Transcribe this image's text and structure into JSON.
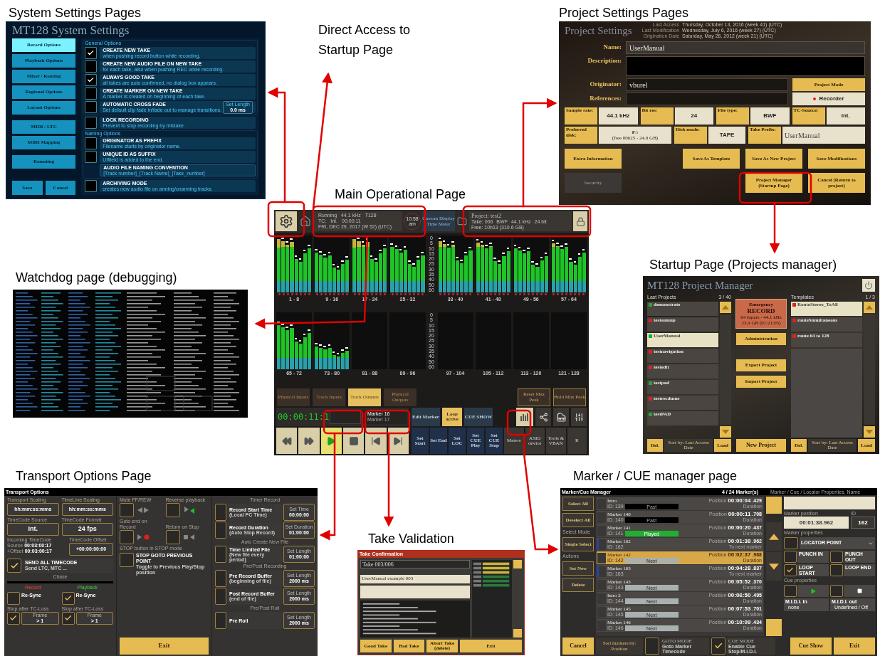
{
  "captions": [
    "System Settings Pages",
    "Direct Access to Startup Page",
    "Project Settings Pages",
    "Main Operational Page",
    "Watchdog page (debugging)",
    "Startup Page (Projects manager)",
    "Transport Options Page",
    "Take Validation",
    "Marker / CUE manager page"
  ],
  "system_settings": {
    "title": "MT128 System Settings",
    "menu_groups": [
      [
        {
          "label": "Record Options",
          "selected": true
        },
        {
          "label": "Playback Options",
          "selected": false
        },
        {
          "label": "Mixer / Routing",
          "selected": false
        },
        {
          "label": "Regional Options",
          "selected": false
        },
        {
          "label": "Layout Options",
          "selected": false
        }
      ],
      [
        {
          "label": "MIDI / LTC",
          "selected": false
        },
        {
          "label": "MIDI Mapping",
          "selected": false
        }
      ],
      [
        {
          "label": "Remoting",
          "selected": false
        }
      ]
    ],
    "footer_buttons": [
      "Save",
      "Cancel"
    ],
    "general_label": "General Options",
    "general_options": [
      {
        "title": "CREATE NEW TAKE",
        "description": "when pushing record button while recording.",
        "checked": true
      },
      {
        "title": "CREATE NEW AUDIO FILE ON NEW TAKE",
        "description": "for each take, also when pushing REC while recording.",
        "checked": false
      },
      {
        "title": "ALWAYS GOOD TAKE",
        "description": "all takes are auto confirmed, no dialog box appears.",
        "checked": true
      },
      {
        "title": "CREATE MARKER ON NEW TAKE",
        "description": "A marker is created on beginning of each take.",
        "checked": false
      },
      {
        "title": "AUTOMATIC CROSS FADE",
        "description": "Set default clip fade in/fade out to manage transitions.",
        "checked": false,
        "setting_label": "Set Length",
        "setting": "0.0 ms"
      }
    ],
    "lock_option": {
      "title": "LOCK RECORDING",
      "description": "Prevent to stop recording by mistake.",
      "checked": false
    },
    "naming_label": "Naming Options",
    "naming_options": [
      {
        "title": "ORIGINATOR AS PREFIX",
        "description": "Filename starts by originator name.",
        "checked": false
      },
      {
        "title": "UNIQUE ID AS SUFFIX",
        "description": "UIfileId is added to the end.",
        "checked": false
      }
    ],
    "naming_convention": {
      "title": "AUDIO FILE NAMING CONVENTION",
      "description": "[Track number]_[Track Name]_[Take_number]"
    },
    "archiving_option": {
      "title": "ARCHIVING MODE",
      "description": "creates new audio file on arming/unarming tracks.",
      "checked": false
    }
  },
  "project_settings": {
    "title": "Project Settings",
    "meta": [
      {
        "label": "Last Access",
        "value": "Thursday, October 13, 2016 (week 41) (UTC)"
      },
      {
        "label": "Last Modification",
        "value": "Wednesday, July 6, 2016 (week 27) (UTC)"
      },
      {
        "label": "Origination Date",
        "value": "Saturday, May 26, 2012 (week 21) (UTC)"
      }
    ],
    "name_label": "Name:",
    "name": "UserManual",
    "description_label": "Description:",
    "originator_label": "Originator:",
    "originator": "vburel",
    "references_label": "References:",
    "project_mode_label": "Project Mode",
    "project_mode": "Recorder",
    "params": [
      {
        "label": "Sample rate:",
        "value": "44.1 kHz"
      },
      {
        "label": "Bit res:",
        "value": "24"
      },
      {
        "label": "File type:",
        "value": "BWF"
      },
      {
        "label": "TC-Source:",
        "value": "Int."
      }
    ],
    "disk": {
      "label": "Preferred disk:",
      "value": "F:\\",
      "detail": "(free 00h25 - 24.0 GB)"
    },
    "disk_mode": {
      "label": "Disk mode:",
      "value": "TAPE"
    },
    "take_prefix": {
      "label": "Take Prefix:",
      "value": "UserManual"
    },
    "buttons": [
      {
        "label": "Extra Information",
        "kind": "gold"
      },
      {
        "label": "Save As Template",
        "kind": "gold"
      },
      {
        "label": "Save As New Project",
        "kind": "gold"
      },
      {
        "label": "Save Modifications",
        "kind": "gold"
      },
      {
        "label": "Security",
        "kind": "dark"
      },
      {
        "label": "Project Manager (Startup Page)",
        "kind": "gold"
      },
      {
        "label": "Cancel (Return to project)",
        "kind": "gold"
      }
    ]
  },
  "main_page": {
    "status": "Running",
    "tc_label": "TC:",
    "rate": "44.1 kHz",
    "tracks": "T128",
    "source": "Int.",
    "timecode": "00:00:11",
    "date": "FRI, DEC 29, 2017 (W 52) (UTC)",
    "clock": "10:58",
    "ampm": "am",
    "display_button": "Custom Display Time Meter",
    "project": "Project: test2",
    "take": "Take: 006",
    "format": "BWF",
    "project_rate": "44.1 kHz",
    "bits": "24 bit",
    "free": "Free: 10h13 (310.6 GB)",
    "meter_rows": [
      {
        "scale": [
          "0",
          "5",
          "10",
          "15",
          "20",
          "25",
          "30",
          "35",
          "40",
          "50",
          "60"
        ],
        "groups": [
          {
            "label": "1 - 8",
            "level": 0.95
          },
          {
            "label": "9 - 16",
            "level": 0.7
          },
          {
            "label": "17 - 24",
            "level": 0.95
          },
          {
            "label": "25 - 32",
            "level": 0.8
          },
          {
            "label": "33 - 40",
            "level": 0.9
          },
          {
            "label": "41 - 48",
            "level": 0.88
          },
          {
            "label": "49 - 56",
            "level": 0.78
          },
          {
            "label": "57 - 64",
            "level": 0.86
          }
        ]
      },
      {
        "scale": [
          "0",
          "5",
          "10",
          "15",
          "20",
          "25",
          "30",
          "35",
          "40",
          "50",
          "60"
        ],
        "groups": [
          {
            "label": "65 - 72",
            "level": 0.78
          },
          {
            "label": "73 - 80",
            "level": 0.4
          },
          {
            "label": "81 - 88",
            "level": 0
          },
          {
            "label": "89 - 96",
            "level": 0
          },
          {
            "label": "97 - 104",
            "level": 0
          },
          {
            "label": "105 - 112",
            "level": 0
          },
          {
            "label": "113 - 120",
            "level": 0
          },
          {
            "label": "121 - 128",
            "level": 0
          }
        ]
      }
    ],
    "tabs": [
      {
        "label": "Physical Inputs",
        "selected": false
      },
      {
        "label": "Track Inputs",
        "selected": false
      },
      {
        "label": "Track Outputs",
        "selected": true
      },
      {
        "label": "Physical Outputs",
        "selected": false
      }
    ],
    "peak_buttons": [
      "Reset Max Peak",
      "Hold Max Peak"
    ],
    "time": "00:00:11:1",
    "marker": "Marker 16",
    "next_marker": "Marker 17",
    "marker_buttons": [
      {
        "label": "Edit Marker",
        "on": false
      },
      {
        "label": "Loop active",
        "on": true
      },
      {
        "label": "CUE SHOW",
        "on": false
      }
    ],
    "set_buttons": [
      "Set Start",
      "Set End",
      "Set LOC",
      "Set CUE Play",
      "Set CUE Stop"
    ],
    "tool_buttons": [
      "Meters",
      "ASIO device",
      "Tools & VBAN",
      "R"
    ]
  },
  "startup_page": {
    "title": "MT128 Project Manager",
    "projects_label": "Last Projects",
    "projects_count": "3 / 40",
    "templates_label": "Templates",
    "templates_count": "1 / 3",
    "projects": [
      {
        "name": "demonstrate",
        "color": "#22aa33",
        "selected": false
      },
      {
        "name": "testsumup",
        "color": "#dd2222",
        "selected": false
      },
      {
        "name": "UserManual",
        "color": "#22aa33",
        "selected": true
      },
      {
        "name": "testnavigation",
        "color": "#dd2222",
        "selected": false
      },
      {
        "name": "testedit",
        "color": "#dd2222",
        "selected": false
      },
      {
        "name": "testpad",
        "color": "#22aa33",
        "selected": false
      },
      {
        "name": "testrecdume",
        "color": "#dd2222",
        "selected": false
      },
      {
        "name": "testPAD",
        "color": "#22aa33",
        "selected": false
      }
    ],
    "templates": [
      {
        "name": "RouteStereo_ToAll",
        "color": "#dd2222",
        "selected": true
      },
      {
        "name": "routeSimultaneous",
        "color": "#dd2222",
        "selected": false
      },
      {
        "name": "route 64 to 128",
        "color": "#dd2222",
        "selected": false
      }
    ],
    "emergency": [
      "Emergency",
      "RECORD",
      "64 Inputs - 44.1 kHz",
      "23.9 GB (01:21:05)"
    ],
    "middle_buttons": [
      "Administration",
      "Export Project",
      "Import Project"
    ],
    "new_project": "New Project",
    "projects_footer": {
      "delete": "Del.",
      "sort": "Sort by: Last Access Date",
      "load": "Load"
    },
    "templates_footer": {
      "delete": "Del.",
      "sort": "Sort by: Last Access Date",
      "load": "Load"
    }
  },
  "transport_options": {
    "title": "Transport Options",
    "transport_scaling": {
      "label": "Transport Scaling",
      "value": "hh:mm:ss:mms"
    },
    "timeline_scaling": {
      "label": "TimeLine Scaling",
      "value": "hh:mm:ss:mms"
    },
    "tc_source": {
      "label": "TimeCode Source",
      "value": "Int."
    },
    "tc_format": {
      "label": "TimeCode Format",
      "value": "24 fps"
    },
    "incoming": {
      "label": "Incoming TimeCode",
      "source_label": "Source",
      "source": "00:03:00:17",
      "offset_label": "+Offset",
      "offset": "00:03:00:17"
    },
    "tc_offset": {
      "label": "TimeCode Offset",
      "value": "+00:00:00:00"
    },
    "send_all": {
      "title": "SEND ALL TIMECODE",
      "description": "Send LTC, MTC ...",
      "checked": true
    },
    "chase_label": "Chase",
    "record_label": "Record",
    "playback_label": "Playback",
    "resync": [
      {
        "label": "Re-Sync",
        "checked": false
      },
      {
        "label": "Re-Sync",
        "checked": true
      }
    ],
    "stop_after": [
      {
        "label": "Stop after TC-Loss",
        "checked": true,
        "frame_label": "Frame",
        "frame": "> 1"
      },
      {
        "label": "Stop after TC-Loss",
        "checked": true,
        "frame_label": "Frame",
        "frame": "> 1"
      }
    ],
    "toggles": [
      {
        "label": "Mute FF/REW",
        "checked": false,
        "kind": "ffrew"
      },
      {
        "label": "Reverse playback",
        "checked": false,
        "kind": "reverse"
      },
      {
        "label": "Goto end on Record",
        "checked": false,
        "kind": "record"
      },
      {
        "label": "Return on Stop",
        "checked": false,
        "kind": "stop"
      }
    ],
    "stop_mode": {
      "label": "STOP button in STOP mode",
      "title": "STOP GOTO PREVIOUS POINT",
      "description": "Toggle to Previous Play/Stop position",
      "checked": false
    },
    "exit": "Exit",
    "sections": [
      {
        "heading": "Timer Record",
        "items": [
          {
            "title": "Record Start Time",
            "description": "(Local PC Time)",
            "setting_label": "Set Time",
            "setting": "00:00:00",
            "checked": false
          },
          {
            "title": "Record Duration",
            "description": "(Auto Stop Record)",
            "setting_label": "Set Duration",
            "setting": "01:00:00",
            "checked": false
          }
        ]
      },
      {
        "heading": "Auto Create New File",
        "items": [
          {
            "title": "Time Limited File",
            "description": "(New file every period)",
            "setting_label": "Set Length",
            "setting": "01:00:00",
            "checked": false
          }
        ]
      },
      {
        "heading": "Pre/Post Recording",
        "items": [
          {
            "title": "Pre Record Buffer",
            "description": "(beginning of file)",
            "setting_label": "Set Length",
            "setting": "2000 ms",
            "checked": false
          },
          {
            "title": "Post Record Buffer",
            "description": "(end of file)",
            "setting_label": "Set Length",
            "setting": "2000 ms",
            "checked": false
          }
        ]
      },
      {
        "heading": "Pre/Post Roll",
        "items": [
          {
            "title": "Pre Roll",
            "setting_label": "Set Length",
            "setting": "2000 ms",
            "checked": false
          }
        ]
      }
    ]
  },
  "take_validation": {
    "title": "Take Confirmation",
    "take": "Take 003/006",
    "name": "UserManual example 003",
    "buttons": [
      "Good Take",
      "Bad Take",
      "Abort Take (delete)",
      "Exit"
    ]
  },
  "marker_manager": {
    "title": "Marker/Cue Manager",
    "count": "4 / 24 Marker(s)",
    "properties_title": "Marker / Cue / Locator Properties, Name",
    "select_buttons": [
      "Select All",
      "Deselect All"
    ],
    "select_mode_label": "Select Mode",
    "select_mode": "Single Select",
    "actions_label": "Actions",
    "actions": [
      "Set New",
      "Delete"
    ],
    "cancel": "Cancel",
    "markers": [
      {
        "name": "Intro",
        "id": "ID: 139",
        "kind": "past",
        "status": "Past",
        "position_label": "Position",
        "position": "00:00:04",
        "ms": ".429",
        "second_label": "Duration",
        "selected": false
      },
      {
        "name": "Marker 140",
        "id": "ID: 140",
        "kind": "past",
        "status": "Past",
        "position_label": "Position",
        "position": "00:00:11",
        "ms": ".708",
        "second_label": "Duration",
        "selected": false
      },
      {
        "name": "Marker 141",
        "id": "ID: 141",
        "kind": "played",
        "status": "Played",
        "position_label": "Position",
        "position": "00:00:20",
        "ms": ".437",
        "second_label": "Duration",
        "selected": false
      },
      {
        "name": "Marker 162",
        "id": "ID: 162",
        "kind": "locator",
        "position_label": "Position",
        "position": "00:01:38",
        "ms": ".962",
        "second_label": "To next marker",
        "selected": false
      },
      {
        "name": "Marker 142",
        "id": "ID: 142",
        "kind": "next",
        "status": "Next",
        "position_label": "Position",
        "position": "00:02:37",
        "ms": ".968",
        "second_label": "Duration",
        "selected": true
      },
      {
        "name": "Marker 163",
        "id": "ID: 163",
        "kind": "locator",
        "position_label": "Position",
        "position": "00:04:28",
        "ms": ".837",
        "second_label": "To next marker",
        "selected": false
      },
      {
        "name": "Marker 143",
        "id": "ID: 143",
        "kind": "next",
        "status": "Next",
        "position_label": "Position",
        "position": "00:05:52",
        "ms": ".370",
        "second_label": "Duration",
        "selected": false
      },
      {
        "name": "Intro 2",
        "id": "ID: 144",
        "kind": "next",
        "status": "Next",
        "position_label": "Position",
        "position": "00:06:50",
        "ms": ".495",
        "second_label": "Duration",
        "selected": false
      },
      {
        "name": "Marker 145",
        "id": "ID: 145",
        "kind": "next",
        "status": "Next",
        "position_label": "Position",
        "position": "00:07:53",
        "ms": ".701",
        "second_label": "Duration",
        "selected": false
      },
      {
        "name": "Marker 146",
        "id": "ID: 146",
        "kind": "next",
        "status": "Next",
        "position_label": "Position",
        "position": "00:10:09",
        "ms": ".434",
        "second_label": "Duration",
        "selected": false
      }
    ],
    "marker_position_label": "Marker position",
    "marker_position": "00:01:38.962",
    "id_label": "ID",
    "id": "162",
    "marker_properties_label": "Marker properties",
    "marker_type_checked": false,
    "marker_type": "LOCATOR POINT",
    "toggles": [
      {
        "label": "PUNCH IN",
        "checked": false
      },
      {
        "label": "PUNCH OUT",
        "checked": false
      },
      {
        "label": "LOOP START",
        "checked": true
      },
      {
        "label": "LOOP END",
        "checked": false
      }
    ],
    "cue_properties_label": "Cue properties",
    "cue_toggles": [
      {
        "kind": "play",
        "checked": false
      },
      {
        "kind": "stop",
        "checked": false
      }
    ],
    "midi": [
      {
        "label": "M.I.D.I. in",
        "value": "none"
      },
      {
        "label": "M.I.D.I. out",
        "value": "Undefined / Off"
      }
    ],
    "sort_label": "Sort markers by:",
    "sort": "Position",
    "modes": [
      {
        "title": "GOTO MODE",
        "description": "Goto Marker Timecode",
        "checked": false
      },
      {
        "title": "CUE MODE",
        "description": "Enable Cue Stop/M.I.D.I.",
        "checked": true
      }
    ],
    "bottom_buttons": [
      "Cue Show",
      "Exit"
    ]
  }
}
